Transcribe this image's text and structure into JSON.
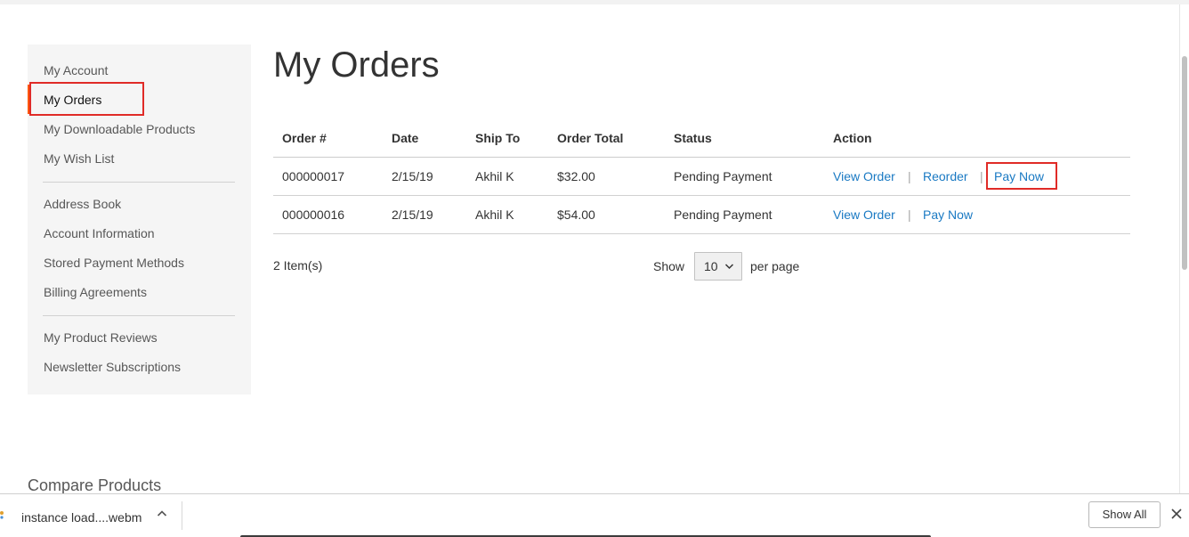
{
  "sidebar": {
    "group1": [
      "My Account",
      "My Orders",
      "My Downloadable Products",
      "My Wish List"
    ],
    "group2": [
      "Address Book",
      "Account Information",
      "Stored Payment Methods",
      "Billing Agreements"
    ],
    "group3": [
      "My Product Reviews",
      "Newsletter Subscriptions"
    ],
    "current": "My Orders"
  },
  "page": {
    "title": "My Orders"
  },
  "orders": {
    "headers": {
      "order": "Order #",
      "date": "Date",
      "ship_to": "Ship To",
      "total": "Order Total",
      "status": "Status",
      "action": "Action"
    },
    "rows": [
      {
        "order": "000000017",
        "date": "2/15/19",
        "ship_to": "Akhil K",
        "total": "$32.00",
        "status": "Pending Payment",
        "actions": {
          "view": "View Order",
          "reorder": "Reorder",
          "pay": "Pay Now"
        }
      },
      {
        "order": "000000016",
        "date": "2/15/19",
        "ship_to": "Akhil K",
        "total": "$54.00",
        "status": "Pending Payment",
        "actions": {
          "view": "View Order",
          "pay": "Pay Now"
        }
      }
    ],
    "separator": "|"
  },
  "toolbar": {
    "items_count": "2 Item(s)",
    "show_label": "Show",
    "limit_value": "10",
    "per_page": "per page"
  },
  "compare": {
    "title": "Compare Products"
  },
  "download_bar": {
    "file_name": "instance load....webm",
    "show_all": "Show All"
  },
  "colors": {
    "link": "#1979c3",
    "highlight_box": "#e02b27",
    "sidebar_bg": "#f5f5f5"
  },
  "icons": {
    "limiter": "chevron-down-icon",
    "download_menu": "chevron-up-icon",
    "download_close": "close-icon",
    "file": "file-icon"
  }
}
